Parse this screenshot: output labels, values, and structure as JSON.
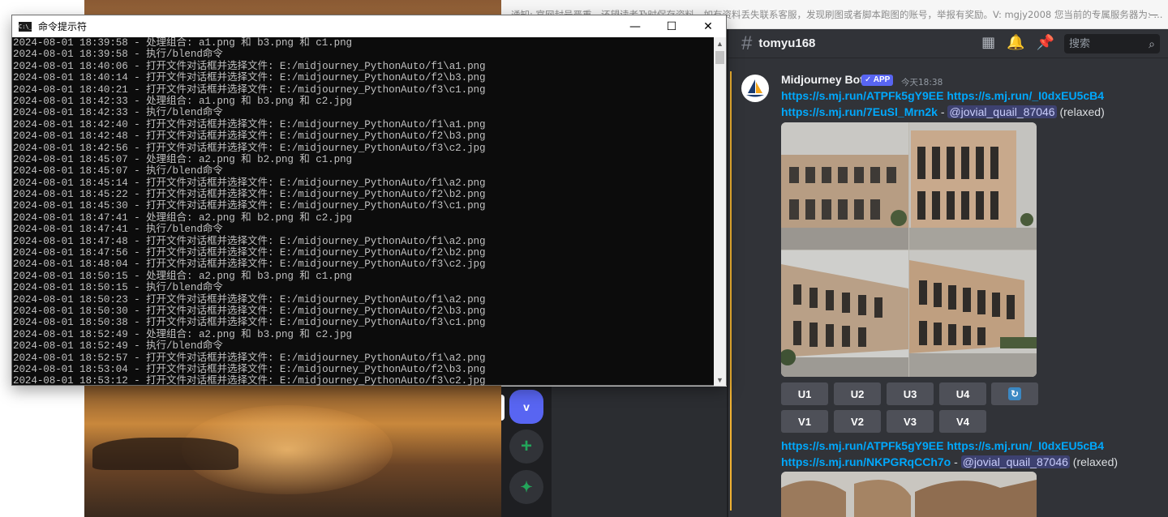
{
  "cmd": {
    "title": "命令提示符",
    "icon_label": "C:\\_",
    "minimize": "—",
    "maximize": "☐",
    "close": "✕",
    "lines": [
      "2024-08-01 18:39:58 - 处理组合: a1.png 和 b3.png 和 c1.png",
      "2024-08-01 18:39:58 - 执行/blend命令",
      "2024-08-01 18:40:06 - 打开文件对话框并选择文件: E:/midjourney_PythonAuto/f1\\a1.png",
      "2024-08-01 18:40:14 - 打开文件对话框并选择文件: E:/midjourney_PythonAuto/f2\\b3.png",
      "2024-08-01 18:40:21 - 打开文件对话框并选择文件: E:/midjourney_PythonAuto/f3\\c1.png",
      "2024-08-01 18:42:33 - 处理组合: a1.png 和 b3.png 和 c2.jpg",
      "2024-08-01 18:42:33 - 执行/blend命令",
      "2024-08-01 18:42:40 - 打开文件对话框并选择文件: E:/midjourney_PythonAuto/f1\\a1.png",
      "2024-08-01 18:42:48 - 打开文件对话框并选择文件: E:/midjourney_PythonAuto/f2\\b3.png",
      "2024-08-01 18:42:56 - 打开文件对话框并选择文件: E:/midjourney_PythonAuto/f3\\c2.jpg",
      "2024-08-01 18:45:07 - 处理组合: a2.png 和 b2.png 和 c1.png",
      "2024-08-01 18:45:07 - 执行/blend命令",
      "2024-08-01 18:45:14 - 打开文件对话框并选择文件: E:/midjourney_PythonAuto/f1\\a2.png",
      "2024-08-01 18:45:22 - 打开文件对话框并选择文件: E:/midjourney_PythonAuto/f2\\b2.png",
      "2024-08-01 18:45:30 - 打开文件对话框并选择文件: E:/midjourney_PythonAuto/f3\\c1.png",
      "2024-08-01 18:47:41 - 处理组合: a2.png 和 b2.png 和 c2.jpg",
      "2024-08-01 18:47:41 - 执行/blend命令",
      "2024-08-01 18:47:48 - 打开文件对话框并选择文件: E:/midjourney_PythonAuto/f1\\a2.png",
      "2024-08-01 18:47:56 - 打开文件对话框并选择文件: E:/midjourney_PythonAuto/f2\\b2.png",
      "2024-08-01 18:48:04 - 打开文件对话框并选择文件: E:/midjourney_PythonAuto/f3\\c2.jpg",
      "2024-08-01 18:50:15 - 处理组合: a2.png 和 b3.png 和 c1.png",
      "2024-08-01 18:50:15 - 执行/blend命令",
      "2024-08-01 18:50:23 - 打开文件对话框并选择文件: E:/midjourney_PythonAuto/f1\\a2.png",
      "2024-08-01 18:50:30 - 打开文件对话框并选择文件: E:/midjourney_PythonAuto/f2\\b3.png",
      "2024-08-01 18:50:38 - 打开文件对话框并选择文件: E:/midjourney_PythonAuto/f3\\c1.png",
      "2024-08-01 18:52:49 - 处理组合: a2.png 和 b3.png 和 c2.jpg",
      "2024-08-01 18:52:49 - 执行/blend命令",
      "2024-08-01 18:52:57 - 打开文件对话框并选择文件: E:/midjourney_PythonAuto/f1\\a2.png",
      "2024-08-01 18:53:04 - 打开文件对话框并选择文件: E:/midjourney_PythonAuto/f2\\b3.png",
      "2024-08-01 18:53:12 - 打开文件对话框并选择文件: E:/midjourney_PythonAuto/f3\\c2.jpg"
    ]
  },
  "notice": {
    "text": "通知: 官网封号严重，还望读者及时保存资料，如有资料丢失联系客服，发现刷图或者脚本跑图的账号，举报有奖励。V: mgjy2008 您当前的专属服务器为: ...",
    "dash": "—"
  },
  "server_rail": {
    "server_v": "v",
    "add": "+",
    "explore": "✦"
  },
  "discord": {
    "channel": "tomyu168",
    "search_placeholder": "搜索",
    "message": {
      "author": "Midjourney Bot",
      "badge": "✓ APP",
      "time": "今天18:38",
      "link1": "https://s.mj.run/ATPFk5gY9EE",
      "link2": "https://s.mj.run/_I0dxEU5cB4",
      "link3": "https://s.mj.run/7EuSl_Mrn2k",
      "separator": " - ",
      "mention": "@jovial_quail_87046",
      "mode": " (relaxed)",
      "buttons_u": [
        "U1",
        "U2",
        "U3",
        "U4"
      ],
      "buttons_v": [
        "V1",
        "V2",
        "V3",
        "V4"
      ],
      "refresh": "↻"
    },
    "message2": {
      "link1": "https://s.mj.run/ATPFk5gY9EE",
      "link2": "https://s.mj.run/_I0dxEU5cB4",
      "link3": "https://s.mj.run/NKPGRqCCh7o",
      "separator": " - ",
      "mention": "@jovial_quail_87046",
      "mode": " (relaxed)"
    }
  },
  "colors": {
    "discord_bg": "#313338",
    "blurple": "#5865f2",
    "link": "#00a8fc",
    "cmd_bg": "#0c0c0c",
    "cmd_text": "#c0c0c0"
  }
}
